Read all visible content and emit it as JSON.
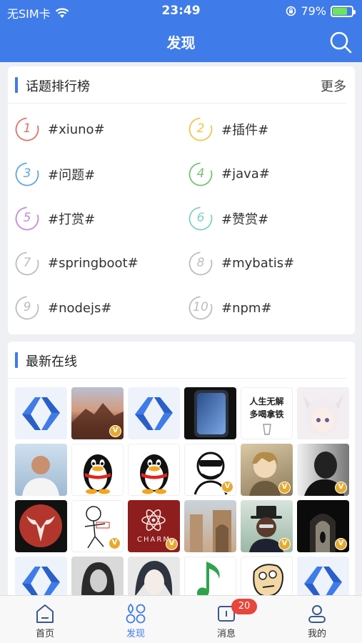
{
  "status": {
    "carrier": "无SIM卡",
    "time": "23:49",
    "battery": "79%"
  },
  "header": {
    "title": "发现"
  },
  "topics_card": {
    "title": "话题排行榜",
    "more": "更多",
    "items": [
      {
        "rank": "1",
        "label": "#xiuno#",
        "color": "#e0735f"
      },
      {
        "rank": "2",
        "label": "#插件#",
        "color": "#f0c54f"
      },
      {
        "rank": "3",
        "label": "#问题#",
        "color": "#5ea6e6"
      },
      {
        "rank": "4",
        "label": "#java#",
        "color": "#76c373"
      },
      {
        "rank": "5",
        "label": "#打赏#",
        "color": "#c48ad8"
      },
      {
        "rank": "6",
        "label": "#赞赏#",
        "color": "#7fd0c6"
      },
      {
        "rank": "7",
        "label": "#springboot#",
        "color": "#bdbdbd"
      },
      {
        "rank": "8",
        "label": "#mybatis#",
        "color": "#bdbdbd"
      },
      {
        "rank": "9",
        "label": "#nodejs#",
        "color": "#bdbdbd"
      },
      {
        "rank": "10",
        "label": "#npm#",
        "color": "#bdbdbd"
      }
    ]
  },
  "online_card": {
    "title": "最新在线",
    "text_avatar_line1": "人生无解",
    "text_avatar_line2": "多喝拿铁",
    "charm_text": "CHARM",
    "verified_mark": "V"
  },
  "tabbar": {
    "tabs": [
      {
        "label": "首页",
        "icon": "home-icon"
      },
      {
        "label": "发现",
        "icon": "discover-icon"
      },
      {
        "label": "消息",
        "icon": "message-icon",
        "badge": "20"
      },
      {
        "label": "我的",
        "icon": "profile-icon"
      }
    ]
  }
}
